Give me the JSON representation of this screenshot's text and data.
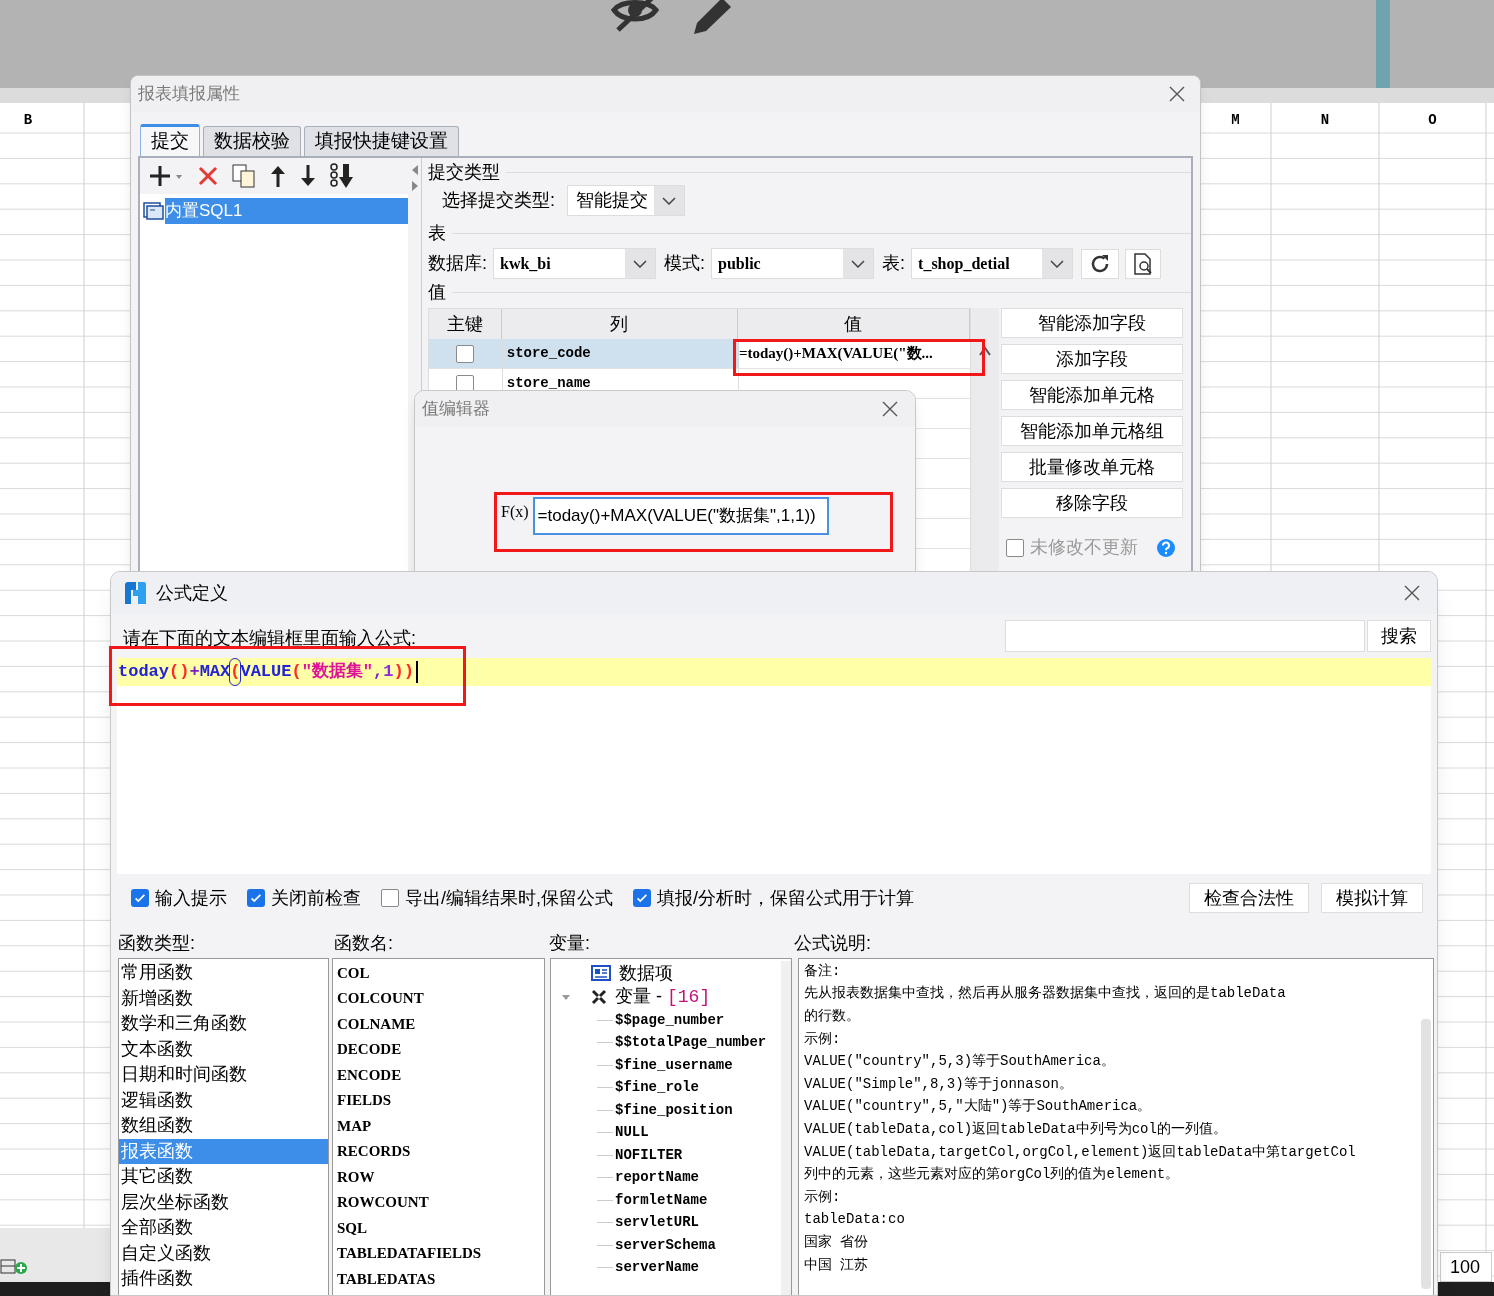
{
  "background": {
    "columns": [
      {
        "label": "B"
      },
      {
        "label": "M"
      },
      {
        "label": "N"
      },
      {
        "label": "O"
      }
    ],
    "zoom": "100"
  },
  "submit_dialog": {
    "title": "报表填报属性",
    "tabs": [
      {
        "label": "提交",
        "selected": true
      },
      {
        "label": "数据校验",
        "selected": false
      },
      {
        "label": "填报快捷键设置",
        "selected": false
      }
    ],
    "tree": [
      {
        "label": "内置SQL1",
        "selected": true
      }
    ],
    "submit_type_section": "提交类型",
    "submit_type_label": "选择提交类型:",
    "submit_type": "智能提交",
    "table_section": "表",
    "database_label": "数据库:",
    "database": "kwk_bi",
    "schema_label": "模式:",
    "schema": "public",
    "table_label": "表:",
    "table": "t_shop_detial",
    "values_section": "值",
    "columns": [
      "主键",
      "列",
      "值"
    ],
    "rows": [
      {
        "key": false,
        "column": "store_code",
        "value": "=today()+MAX(VALUE(\"数...",
        "selected": true
      },
      {
        "key": false,
        "column": "store_name",
        "selected": false
      }
    ],
    "buttons": [
      "智能添加字段",
      "添加字段",
      "智能添加单元格",
      "智能添加单元格组",
      "批量修改单元格",
      "移除字段"
    ],
    "no_update": {
      "label": "未修改不更新",
      "checked": false
    }
  },
  "value_editor": {
    "title": "值编辑器",
    "fx": "F(x)",
    "value": "=today()+MAX(VALUE(\"数据集\",1,1))"
  },
  "formula_dialog": {
    "title": "公式定义",
    "prompt": "请在下面的文本编辑框里面输入公式:",
    "search_button": "搜索",
    "formula": [
      {
        "text": "today",
        "kind": "function",
        "matched": false
      },
      {
        "text": "()",
        "kind": "paren",
        "matched": false
      },
      {
        "text": "+",
        "kind": "operator",
        "matched": false
      },
      {
        "text": "MAX",
        "kind": "function",
        "matched": false
      },
      {
        "text": "(",
        "kind": "paren",
        "matched": true
      },
      {
        "text": "VALUE",
        "kind": "function",
        "matched": false
      },
      {
        "text": "(",
        "kind": "paren",
        "matched": false
      },
      {
        "text": "\"数据集\"",
        "kind": "string",
        "matched": false
      },
      {
        "text": ",",
        "kind": "operator",
        "matched": false
      },
      {
        "text": "1",
        "kind": "number",
        "matched": false
      },
      {
        "text": "))",
        "kind": "paren",
        "matched": false
      }
    ],
    "options": [
      {
        "label": "输入提示",
        "checked": true
      },
      {
        "label": "关闭前检查",
        "checked": true
      },
      {
        "label": "导出/编辑结果时,保留公式",
        "checked": false
      },
      {
        "label": "填报/分析时，保留公式用于计算",
        "checked": true
      }
    ],
    "buttons": [
      "检查合法性",
      "模拟计算"
    ],
    "function_types": {
      "label": "函数类型:",
      "items": [
        {
          "label": "常用函数",
          "selected": false
        },
        {
          "label": "新增函数",
          "selected": false
        },
        {
          "label": "数学和三角函数",
          "selected": false
        },
        {
          "label": "文本函数",
          "selected": false
        },
        {
          "label": "日期和时间函数",
          "selected": false
        },
        {
          "label": "逻辑函数",
          "selected": false
        },
        {
          "label": "数组函数",
          "selected": false
        },
        {
          "label": "报表函数",
          "selected": true
        },
        {
          "label": "其它函数",
          "selected": false
        },
        {
          "label": "层次坐标函数",
          "selected": false
        },
        {
          "label": "全部函数",
          "selected": false
        },
        {
          "label": "自定义函数",
          "selected": false
        },
        {
          "label": "插件函数",
          "selected": false
        }
      ]
    },
    "function_names": {
      "label": "函数名:",
      "items": [
        {
          "label": "COL",
          "selected": false
        },
        {
          "label": "COLCOUNT",
          "selected": false
        },
        {
          "label": "COLNAME",
          "selected": false
        },
        {
          "label": "DECODE",
          "selected": false
        },
        {
          "label": "ENCODE",
          "selected": false
        },
        {
          "label": "FIELDS",
          "selected": false
        },
        {
          "label": "MAP",
          "selected": false
        },
        {
          "label": "RECORDS",
          "selected": false
        },
        {
          "label": "ROW",
          "selected": false
        },
        {
          "label": "ROWCOUNT",
          "selected": false
        },
        {
          "label": "SQL",
          "selected": false
        },
        {
          "label": "TABLEDATAFIELDS",
          "selected": false
        },
        {
          "label": "TABLEDATAS",
          "selected": false
        }
      ]
    },
    "variables": {
      "label": "变量:",
      "tree": [
        {
          "label": "数据项",
          "kind": "dataset"
        },
        {
          "label": "变量 - ",
          "count": "[16]",
          "kind": "group",
          "expanded": true,
          "children": [
            {
              "label": "$$page_number"
            },
            {
              "label": "$$totalPage_number"
            },
            {
              "label": "$fine_username"
            },
            {
              "label": "$fine_role"
            },
            {
              "label": "$fine_position"
            },
            {
              "label": "NULL"
            },
            {
              "label": "NOFILTER"
            },
            {
              "label": "reportName"
            },
            {
              "label": "formletName"
            },
            {
              "label": "servletURL"
            },
            {
              "label": "serverSchema"
            },
            {
              "label": "serverName"
            }
          ]
        }
      ]
    },
    "description": {
      "label": "公式说明:",
      "lines": [
        "备注:",
        "先从报表数据集中查找，然后再从服务器数据集中查找，返回的是tableData",
        "的行数。",
        "示例:",
        "VALUE(\"country\",5,3)等于SouthAmerica。",
        "VALUE(\"Simple\",8,3)等于jonnason。",
        "VALUE(\"country\",5,\"大陆\")等于SouthAmerica。",
        "VALUE(tableData,col)返回tableData中列号为col的一列值。",
        "VALUE(tableData,targetCol,orgCol,element)返回tableData中第targetCol",
        "列中的元素，这些元素对应的第orgCol列的值为element。",
        "示例:",
        "tableData:co",
        "国家 省份",
        "中国 江苏"
      ]
    }
  }
}
